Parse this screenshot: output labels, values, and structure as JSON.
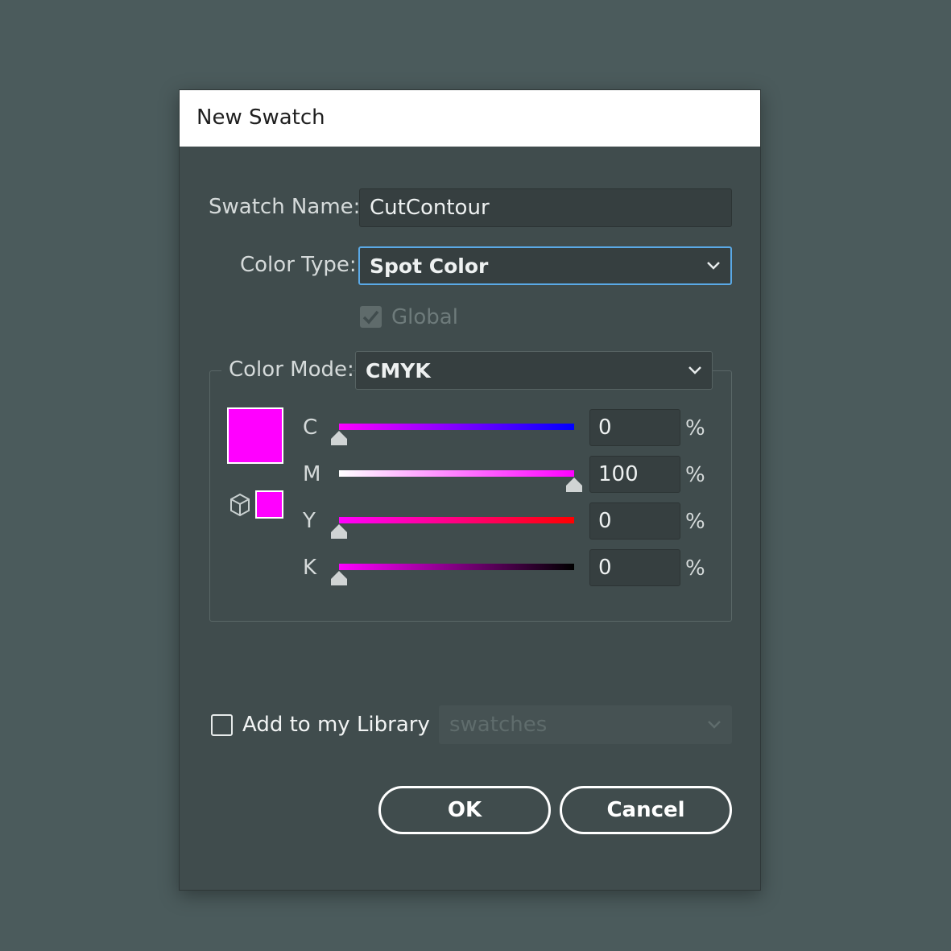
{
  "dialog": {
    "title": "New Swatch",
    "swatch_name": {
      "label": "Swatch Name:",
      "value": "CutContour"
    },
    "color_type": {
      "label": "Color Type:",
      "value": "Spot Color"
    },
    "global": {
      "label": "Global",
      "checked": true,
      "enabled": false
    },
    "color_mode": {
      "label": "Color Mode:",
      "value": "CMYK"
    },
    "preview_color": "#ff00ff",
    "channels": [
      {
        "letter": "C",
        "value": "0",
        "unit": "%",
        "fraction": 0.0,
        "gradient": [
          "#ff00ff",
          "#0000ff"
        ]
      },
      {
        "letter": "M",
        "value": "100",
        "unit": "%",
        "fraction": 1.0,
        "gradient": [
          "#ffffff",
          "#ff00ff"
        ]
      },
      {
        "letter": "Y",
        "value": "0",
        "unit": "%",
        "fraction": 0.0,
        "gradient": [
          "#ff00ff",
          "#ff0000"
        ]
      },
      {
        "letter": "K",
        "value": "0",
        "unit": "%",
        "fraction": 0.0,
        "gradient": [
          "#ff00ff",
          "#000000"
        ]
      }
    ],
    "library": {
      "label": "Add to my Library",
      "checked": false,
      "select_value": "swatches"
    },
    "ok_label": "OK",
    "cancel_label": "Cancel"
  }
}
